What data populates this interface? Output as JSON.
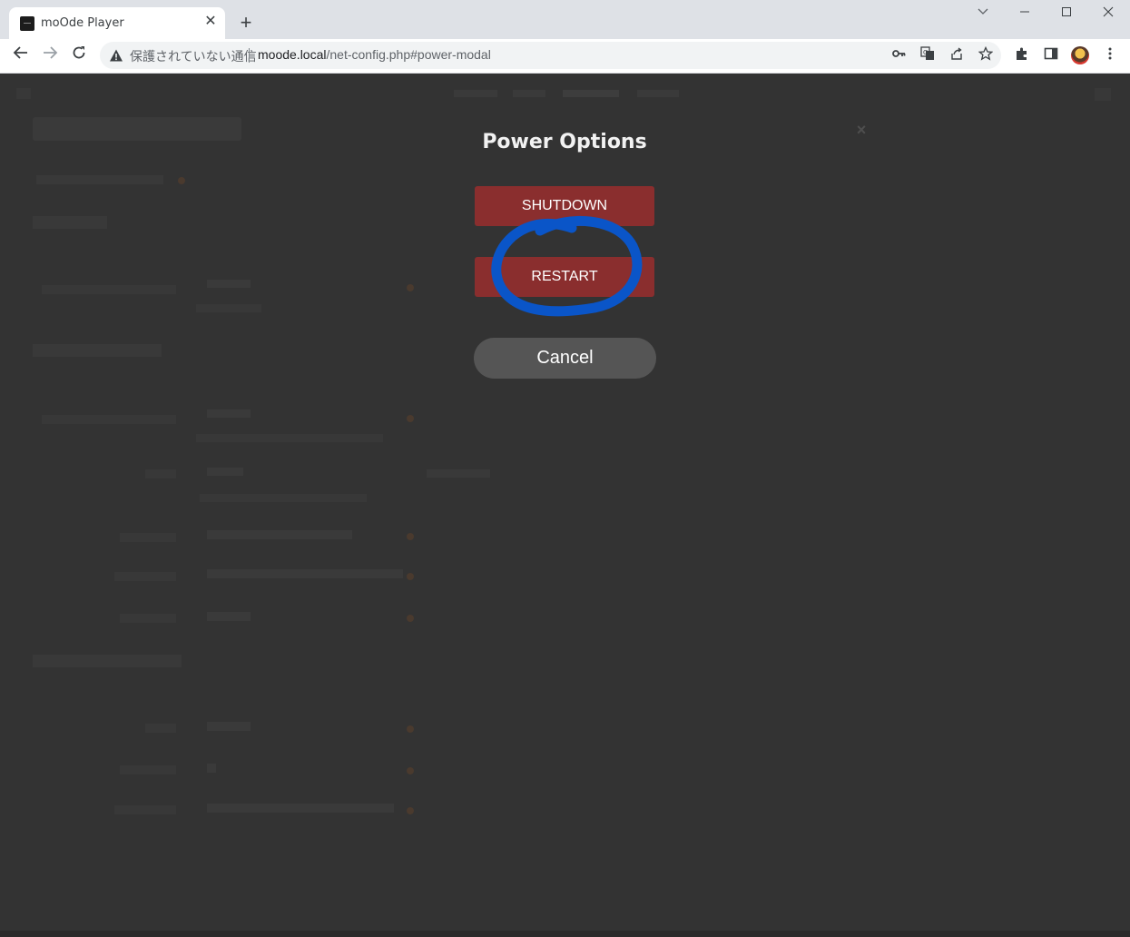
{
  "browser": {
    "tab_title": "moOde Player",
    "tab_close": "✕",
    "new_tab": "+",
    "security_label": "保護されていない通信",
    "url_host": "moode.local",
    "url_path": "/net-config.php#power-modal"
  },
  "modal": {
    "title": "Power Options",
    "close": "×",
    "shutdown_label": "SHUTDOWN",
    "restart_label": "RESTART",
    "cancel_label": "Cancel"
  },
  "colors": {
    "page_background": "#333333",
    "power_button": "#8a2e2e",
    "cancel_button": "#555555",
    "annotation_circle": "#0a55c8"
  }
}
